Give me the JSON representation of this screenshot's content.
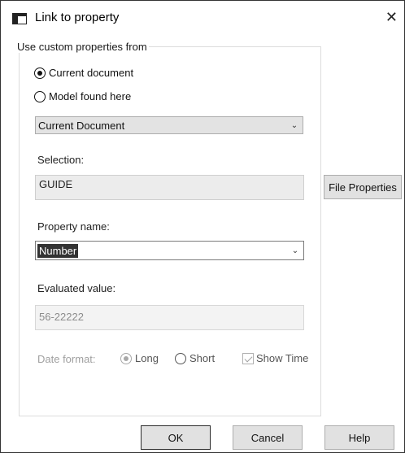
{
  "window": {
    "title": "Link to property",
    "close_label": "✕"
  },
  "source_group": {
    "legend": "Use custom properties from",
    "options": [
      {
        "label": "Current document",
        "selected": true
      },
      {
        "label": "Model found here",
        "selected": false
      }
    ],
    "document_combo": {
      "value": "Current Document"
    }
  },
  "selection": {
    "label": "Selection:",
    "value": "GUIDE"
  },
  "property_name": {
    "label": "Property name:",
    "value": "Number"
  },
  "evaluated_value": {
    "label": "Evaluated value:",
    "value": "56-22222"
  },
  "date_format": {
    "label": "Date format:",
    "options": [
      {
        "label": "Long",
        "selected": true
      },
      {
        "label": "Short",
        "selected": false
      }
    ],
    "show_time": {
      "label": "Show Time",
      "checked": true
    }
  },
  "buttons": {
    "file_properties": "File Properties",
    "ok": "OK",
    "cancel": "Cancel",
    "help": "Help"
  },
  "icons": {
    "window": "window-icon",
    "close": "close-icon",
    "chevron": "chevron-down-icon"
  }
}
